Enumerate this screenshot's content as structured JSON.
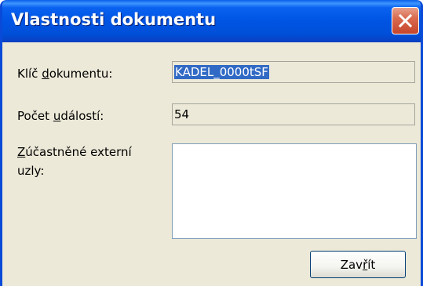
{
  "window": {
    "title": "Vlastnosti dokumentu",
    "title_bar_color": "#0054e3",
    "close_icon": "close-icon"
  },
  "fields": {
    "doc_key": {
      "label_pre": "Klíč ",
      "label_accel": "d",
      "label_post": "okumentu:",
      "value": "KADEL_0000tSF"
    },
    "event_count": {
      "label_pre": "Počet ",
      "label_accel": "u",
      "label_post": "dálostí:",
      "value": "54"
    },
    "external_nodes": {
      "label_accel": "Z",
      "label_post": "účastněné externí",
      "label_line2": "uzly:",
      "value": ""
    }
  },
  "buttons": {
    "close_label_pre": "Zav",
    "close_label_accel": "ř",
    "close_label_post": "ít"
  },
  "colors": {
    "dialog_bg": "#ece9d8",
    "selection": "#316ac5"
  }
}
